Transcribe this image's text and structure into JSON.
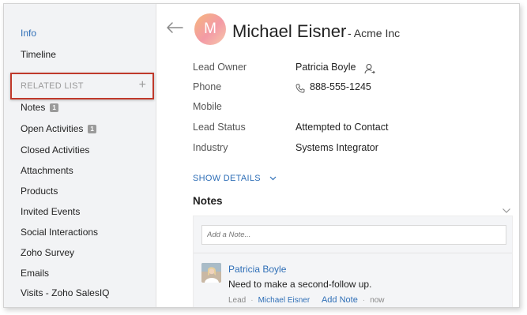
{
  "sidebar": {
    "info": "Info",
    "timeline": "Timeline",
    "related_list": "RELATED LIST",
    "related_add": "+",
    "items": [
      {
        "label": "Notes",
        "count": "1"
      },
      {
        "label": "Open Activities",
        "count": "1"
      },
      {
        "label": "Closed Activities"
      },
      {
        "label": "Attachments"
      },
      {
        "label": "Products"
      },
      {
        "label": "Invited Events"
      },
      {
        "label": "Social Interactions"
      },
      {
        "label": "Zoho Survey"
      },
      {
        "label": "Emails"
      },
      {
        "label": "Visits - Zoho SalesIQ"
      }
    ]
  },
  "header": {
    "avatar_initial": "M",
    "name": "Michael Eisner",
    "company": "- Acme Inc"
  },
  "fields": [
    {
      "label": "Lead Owner",
      "value": "Patricia Boyle"
    },
    {
      "label": "Phone",
      "value": "888-555-1245"
    },
    {
      "label": "Mobile",
      "value": ""
    },
    {
      "label": "Lead Status",
      "value": "Attempted to Contact"
    },
    {
      "label": "Industry",
      "value": "Systems Integrator"
    }
  ],
  "show_details": "SHOW DETAILS",
  "notes": {
    "title": "Notes",
    "placeholder": "Add a Note...",
    "entry": {
      "author": "Patricia Boyle",
      "text": "Need to make a second-follow up.",
      "module": "Lead",
      "record": "Michael Eisner",
      "add_note": "Add Note",
      "time": "now"
    }
  },
  "colors": {
    "accent": "#2f6fb7",
    "highlight_border": "#c0392b",
    "sidebar_bg": "#f2f3f5"
  }
}
